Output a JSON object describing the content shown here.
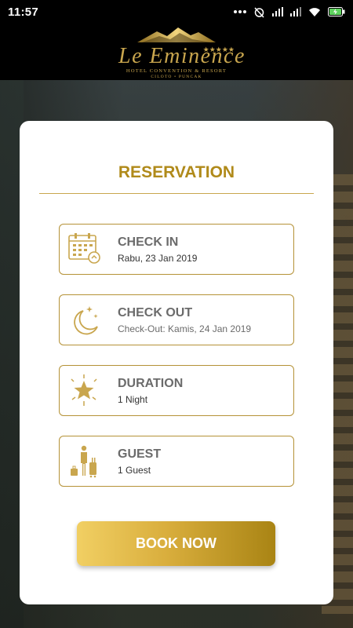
{
  "status_bar": {
    "time": "11:57",
    "icons": [
      "more-dots-icon",
      "alarm-off-icon",
      "signal-icon",
      "signal-icon",
      "wifi-icon",
      "battery-charging-icon"
    ]
  },
  "brand": {
    "name": "Le Eminence",
    "stars": "★★★★★",
    "subtitle": "HOTEL CONVENTION & RESORT",
    "location": "CILOTO • PUNCAK",
    "color": "#c9a64e"
  },
  "reservation": {
    "title": "RESERVATION",
    "check_in": {
      "label": "CHECK IN",
      "value": "Rabu, 23 Jan 2019",
      "icon": "calendar-icon"
    },
    "check_out": {
      "label": "CHECK OUT",
      "value": "Check-Out: Kamis, 24 Jan 2019",
      "icon": "moon-icon"
    },
    "duration": {
      "label": "DURATION",
      "value": "1 Night",
      "icon": "star-icon"
    },
    "guest": {
      "label": "GUEST",
      "value": "1 Guest",
      "icon": "guest-luggage-icon"
    },
    "book_button": "BOOK NOW"
  },
  "colors": {
    "accent": "#b08a1a",
    "border": "#b59237"
  }
}
